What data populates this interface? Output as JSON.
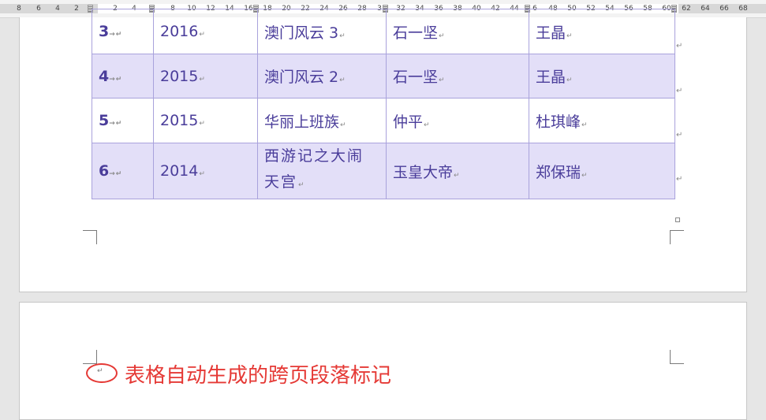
{
  "ruler": {
    "left_numbers": [
      "8",
      "6",
      "4",
      "2"
    ],
    "main_numbers": [
      "2",
      "4",
      "8",
      "10",
      "12",
      "14",
      "16",
      "18",
      "20",
      "22",
      "24",
      "26",
      "28",
      "3",
      "32",
      "34",
      "36",
      "38",
      "40",
      "42",
      "44",
      "6",
      "48",
      "50",
      "52",
      "54",
      "56",
      "58",
      "60",
      "62",
      "64",
      "66",
      "68"
    ]
  },
  "table": {
    "rows": [
      {
        "num": "3",
        "year": "2016",
        "title": "澳门风云 3",
        "role": "石一坚",
        "actor": "王晶",
        "shaded": false
      },
      {
        "num": "4",
        "year": "2015",
        "title": "澳门风云 2",
        "role": "石一坚",
        "actor": "王晶",
        "shaded": true
      },
      {
        "num": "5",
        "year": "2015",
        "title": "华丽上班族",
        "role": "仲平",
        "actor": "杜琪峰",
        "shaded": false
      },
      {
        "num": "6",
        "year": "2014",
        "title_line1": "西游记之大闹",
        "title_line2": "天宫",
        "role": "玉皇大帝",
        "actor": "郑保瑞",
        "shaded": true
      }
    ]
  },
  "marks": {
    "paragraph": "↵",
    "tab_arrow": "→"
  },
  "annotation": {
    "text": "表格自动生成的跨页段落标记",
    "color": "#e53935"
  }
}
